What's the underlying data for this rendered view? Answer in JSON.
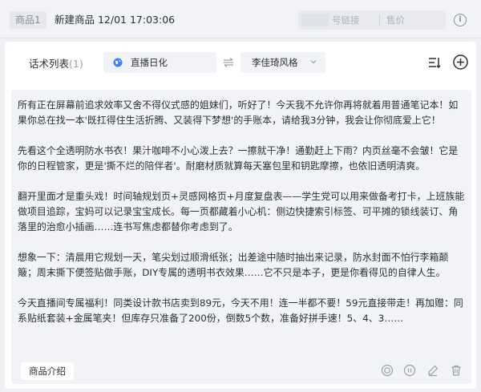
{
  "header": {
    "product_tag": "商品1",
    "product_name": "新建商品 12/01 17:03:06",
    "id_label": "号链接",
    "price_label": "售价",
    "info_icon": "info-icon"
  },
  "toolbar": {
    "list_label": "话术列表",
    "list_count": "(1)",
    "ai_label": "直播日化",
    "style_label": "李佳琦风格"
  },
  "script": {
    "paragraphs": [
      "所有正在屏幕前追求效率又舍不得仪式感的姐妹们，听好了！今天我不允许你再将就着用普通笔记本！如果你总在找一本'既扛得住生活折腾、又装得下梦想'的手账本，请给我3分钟，我会让你彻底爱上它！",
      "先看这个全透明防水书衣！果汁咖啡不小心泼上去？一擦就干净！通勤赶上下雨？内页丝毫不会皱！它是你的日程管家，更是'撕不烂的陪伴者'。耐磨材质就算每天塞包里和钥匙摩擦，也依旧透明清爽。",
      "翻开里面才是重头戏！时间轴规划页+灵感网格页+月度复盘表——学生党可以用来做备考打卡，上班族能做项目追踪，宝妈可以记录宝宝成长。每一页都藏着小心机：侧边快捷索引标签、可平摊的锁线装订、角落里的治愈小插画……连书写焦虑都替你考虑到了。",
      "想象一下：清晨用它规划一天，笔尖划过顺滑纸张；出差途中随时抽出来记录，防水封面不怕行李箱颠簸；周末撕下便签贴做手账，DIY专属的透明书衣效果……它不只是本子，更是你看得见的自律人生。",
      "今天直播间专属福利！同类设计款书店卖到89元，今天不用！连一半都不要！59元直接带走！再加赠：同系贴纸套装+金属笔夹！但库存只准备了200份，倒数5个数，准备好拼手速！5、4、3……"
    ]
  },
  "footer": {
    "tag_label": "商品介绍"
  }
}
